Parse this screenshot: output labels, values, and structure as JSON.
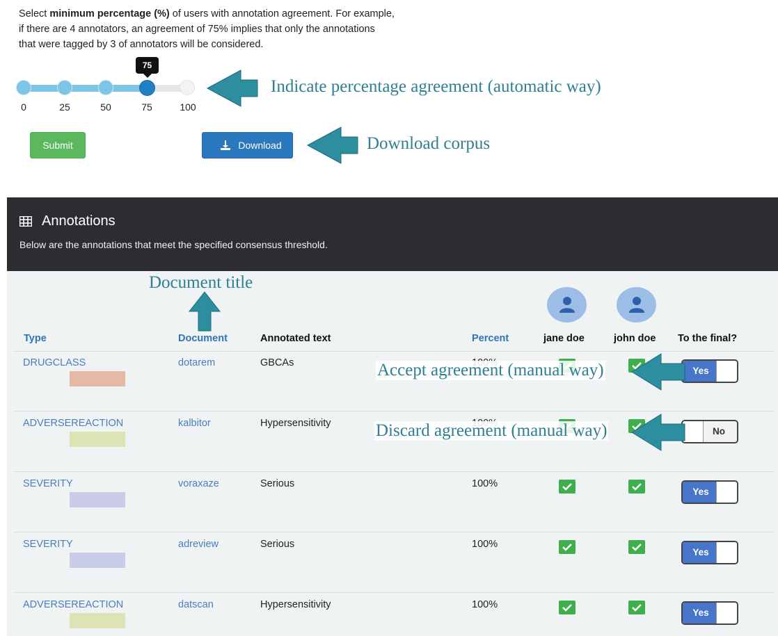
{
  "intro": {
    "pre": "Select ",
    "bold": "minimum percentage (%)",
    "post": " of users with annotation agreement. For example, if there are 4 annotators, an agreement of 75% implies that only the annotations that were tagged by 3 of annotators will be considered."
  },
  "slider": {
    "value": 75,
    "tooltip": "75",
    "ticks": [
      "0",
      "25",
      "50",
      "75",
      "100"
    ]
  },
  "buttons": {
    "submit": "Submit",
    "download": "Download"
  },
  "callouts": {
    "slider": "Indicate percentage agreement (automatic way)",
    "download": "Download corpus",
    "document": "Document title",
    "accept": "Accept agreement (manual way)",
    "discard": "Discard agreement (manual way)"
  },
  "panel": {
    "title": "Annotations",
    "subtitle": "Below are the annotations that meet the specified consensus threshold."
  },
  "table": {
    "headers": {
      "type": "Type",
      "document": "Document",
      "text": "Annotated text",
      "percent": "Percent",
      "user1": "jane doe",
      "user2": "john doe",
      "final": "To the final?"
    },
    "rows": [
      {
        "type": "DRUGCLASS",
        "color": "#e8b8a6",
        "document": "dotarem",
        "text": "GBCAs",
        "percent": "100%",
        "final": "Yes"
      },
      {
        "type": "ADVERSEREACTION",
        "color": "#dde3b5",
        "document": "kalbitor",
        "text": "Hypersensitivity",
        "percent": "100%",
        "final": "No"
      },
      {
        "type": "SEVERITY",
        "color": "#c9cce6",
        "document": "voraxaze",
        "text": "Serious",
        "percent": "100%",
        "final": "Yes"
      },
      {
        "type": "SEVERITY",
        "color": "#c9cce6",
        "document": "adreview",
        "text": "Serious",
        "percent": "100%",
        "final": "Yes"
      },
      {
        "type": "ADVERSEREACTION",
        "color": "#dde3b5",
        "document": "datscan",
        "text": "Hypersensitivity",
        "percent": "100%",
        "final": "Yes"
      }
    ]
  },
  "colors": {
    "accent_blue": "#2a79be",
    "success_green": "#5cb85c",
    "toggle_on": "#4775c9",
    "callout": "#2e7f93",
    "panel_dark": "#2b2d31"
  },
  "icons": [
    "download-icon",
    "table-icon",
    "user-icon",
    "check-icon",
    "arrow-icon"
  ]
}
